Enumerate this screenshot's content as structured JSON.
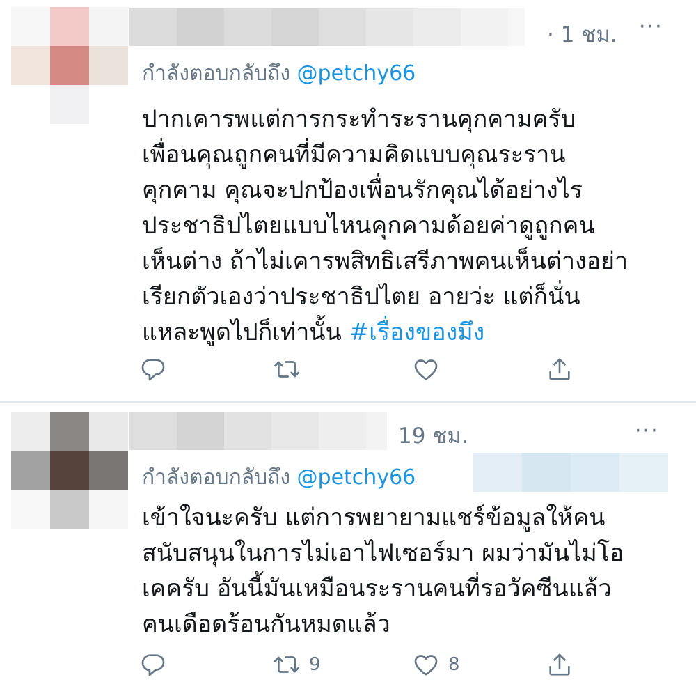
{
  "tweets": [
    {
      "time": "· 1 ชม.",
      "more": "···",
      "reply_prefix": "กำลังตอบกลับถึง",
      "mention": "@petchy66",
      "lines": [
        "ปากเคารพแต่การกระทำระรานคุกคามครับ",
        "เพื่อนคุณถูกคนที่มีความคิดแบบคุณระราน",
        "คุกคาม คุณจะปกป้องเพื่อนรักคุณได้อย่างไร",
        "ประชาธิปไตยแบบไหนคุกคามด้อยค่าดูถูกคน",
        "เห็นต่าง ถ้าไม่เคารพสิทธิเสรีภาพคนเห็นต่างอย่า",
        "เรียกตัวเองว่าประชาธิปไตย อายว่ะ แต่ก็นั่น",
        "แหละพูดไปก็เท่านั้น"
      ],
      "hashtag": "#เรื่องของมึง",
      "retweet_count": "",
      "like_count": ""
    },
    {
      "time": "19 ชม.",
      "more": "···",
      "reply_prefix": "กำลังตอบกลับถึง",
      "mention": "@petchy66",
      "lines": [
        "เข้าใจนะครับ แต่การพยายามแชร์ข้อมูลให้คน",
        "สนับสนุนในการไม่เอาไฟเซอร์มา ผมว่ามันไม่โอ",
        "เคครับ อันนี้มันเหมือนระรานคนที่รอวัคซีนแล้ว",
        "คนเดือดร้อนกันหมดแล้ว"
      ],
      "retweet_count": "9",
      "like_count": "8"
    }
  ],
  "colors": {
    "accent": "#1b95e0",
    "muted": "#657786",
    "text": "#14171a",
    "divider": "#e1e8ed"
  },
  "icons": [
    "reply-icon",
    "retweet-icon",
    "like-icon",
    "share-icon",
    "more-icon"
  ]
}
